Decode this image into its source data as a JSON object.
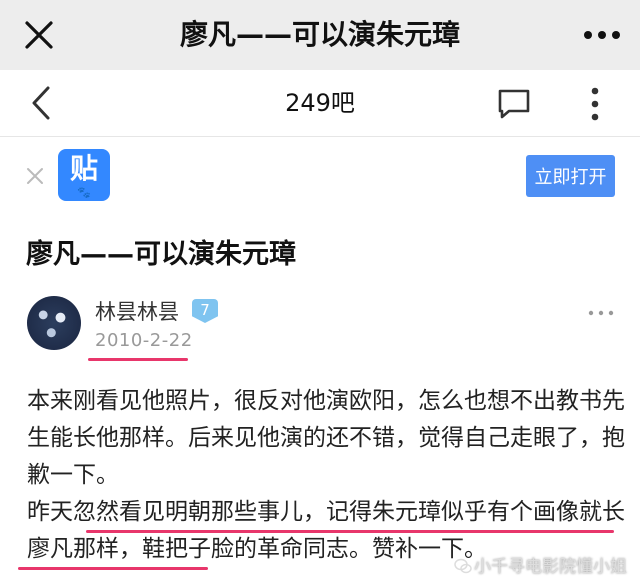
{
  "topbar": {
    "title": "廖凡——可以演朱元璋",
    "close_icon": "close-icon",
    "more_icon": "more-horizontal-icon"
  },
  "navbar": {
    "title": "249吧",
    "back_icon": "back-chevron-icon",
    "comment_icon": "comment-icon",
    "more_icon": "more-vertical-icon"
  },
  "banner": {
    "logo_text": "贴",
    "logo_paw": "🐾",
    "open_label": "立即打开",
    "accent": "#4e8ff5"
  },
  "post": {
    "title": "廖凡——可以演朱元璋",
    "author": "林昙林昙",
    "level": "7",
    "date": "2010-2-22",
    "paragraphs": [
      "本来刚看见他照片，很反对他演欧阳，怎么也想不出教书先生能长他那样。后来见他演的还不错，觉得自己走眼了，抱歉一下。",
      "昨天忽然看见明朝那些事儿，记得朱元璋似乎有个画像就长廖凡那样，鞋把子脸的革命同志。赞补一下。"
    ]
  },
  "watermark": {
    "text": "小千寻电影院懂小姐"
  },
  "colors": {
    "underline": "#e8366b",
    "badge": "#7fc4f0"
  }
}
